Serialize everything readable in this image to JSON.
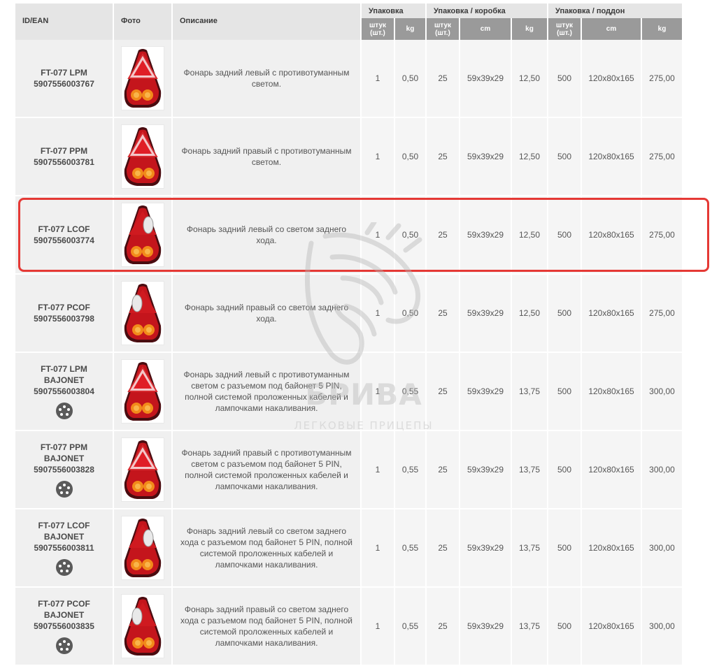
{
  "headers": {
    "id": "ID/EAN",
    "photo": "Фото",
    "description": "Описание",
    "group_pack": "Упаковка",
    "group_box": "Упаковка / коробка",
    "group_pallet": "Упаковка / поддон",
    "sub_pack_pcs": "штук (шт.)",
    "sub_pack_kg": "kg",
    "sub_box_pcs": "штук (шт.)",
    "sub_box_cm": "cm",
    "sub_box_kg": "kg",
    "sub_pallet_pcs": "штук (шт.)",
    "sub_pallet_cm": "cm",
    "sub_pallet_kg": "kg"
  },
  "rows": [
    {
      "model": "FT-077 LPM",
      "suffix": "",
      "ean": "5907556003767",
      "photo_icon": "lamp-left-fog-icon",
      "pin_icon": false,
      "description": "Фонарь задний левый с противотуманным светом.",
      "pack_pcs": "1",
      "pack_kg": "0,50",
      "box_pcs": "25",
      "box_cm": "59x39x29",
      "box_kg": "12,50",
      "pallet_pcs": "500",
      "pallet_cm": "120x80x165",
      "pallet_kg": "275,00"
    },
    {
      "model": "FT-077 PPM",
      "suffix": "",
      "ean": "5907556003781",
      "photo_icon": "lamp-right-fog-icon",
      "pin_icon": false,
      "description": "Фонарь задний правый с противотуманным светом.",
      "pack_pcs": "1",
      "pack_kg": "0,50",
      "box_pcs": "25",
      "box_cm": "59x39x29",
      "box_kg": "12,50",
      "pallet_pcs": "500",
      "pallet_cm": "120x80x165",
      "pallet_kg": "275,00"
    },
    {
      "model": "FT-077 LCOF",
      "suffix": "",
      "ean": "5907556003774",
      "photo_icon": "lamp-left-reverse-icon",
      "pin_icon": false,
      "description": "Фонарь задний левый со светом заднего хода.",
      "pack_pcs": "1",
      "pack_kg": "0,50",
      "box_pcs": "25",
      "box_cm": "59x39x29",
      "box_kg": "12,50",
      "pallet_pcs": "500",
      "pallet_cm": "120x80x165",
      "pallet_kg": "275,00"
    },
    {
      "model": "FT-077 PCOF",
      "suffix": "",
      "ean": "5907556003798",
      "photo_icon": "lamp-right-reverse-icon",
      "pin_icon": false,
      "description": "Фонарь задний правый со светом заднего хода.",
      "pack_pcs": "1",
      "pack_kg": "0,50",
      "box_pcs": "25",
      "box_cm": "59x39x29",
      "box_kg": "12,50",
      "pallet_pcs": "500",
      "pallet_cm": "120x80x165",
      "pallet_kg": "275,00"
    },
    {
      "model": "FT-077 LPM",
      "suffix": "BAJONET",
      "ean": "5907556003804",
      "photo_icon": "lamp-left-fog-icon",
      "pin_icon": true,
      "description": "Фонарь задний левый с противотуманным светом с разъемом под байонет 5 PIN, полной системой проложенных кабелей и лампочками накаливания.",
      "pack_pcs": "1",
      "pack_kg": "0,55",
      "box_pcs": "25",
      "box_cm": "59x39x29",
      "box_kg": "13,75",
      "pallet_pcs": "500",
      "pallet_cm": "120x80x165",
      "pallet_kg": "300,00"
    },
    {
      "model": "FT-077 PPM",
      "suffix": "BAJONET",
      "ean": "5907556003828",
      "photo_icon": "lamp-right-fog-icon",
      "pin_icon": true,
      "description": "Фонарь задний правый с противотуманным светом с разъемом под байонет 5 PIN, полной системой проложенных кабелей и лампочками накаливания.",
      "pack_pcs": "1",
      "pack_kg": "0,55",
      "box_pcs": "25",
      "box_cm": "59x39x29",
      "box_kg": "13,75",
      "pallet_pcs": "500",
      "pallet_cm": "120x80x165",
      "pallet_kg": "300,00"
    },
    {
      "model": "FT-077 LCOF",
      "suffix": "BAJONET",
      "ean": "5907556003811",
      "photo_icon": "lamp-left-reverse-icon",
      "pin_icon": true,
      "description": "Фонарь задний левый со светом заднего хода с разъемом под байонет 5 PIN, полной системой проложенных кабелей и лампочками накаливания.",
      "pack_pcs": "1",
      "pack_kg": "0,55",
      "box_pcs": "25",
      "box_cm": "59x39x29",
      "box_kg": "13,75",
      "pallet_pcs": "500",
      "pallet_cm": "120x80x165",
      "pallet_kg": "300,00"
    },
    {
      "model": "FT-077 PCOF",
      "suffix": "BAJONET",
      "ean": "5907556003835",
      "photo_icon": "lamp-right-reverse-icon",
      "pin_icon": true,
      "description": "Фонарь задний правый со светом заднего хода с разъемом под байонет 5 PIN, полной системой проложенных кабелей и лампочками накаливания.",
      "pack_pcs": "1",
      "pack_kg": "0,55",
      "box_pcs": "25",
      "box_cm": "59x39x29",
      "box_kg": "13,75",
      "pallet_pcs": "500",
      "pallet_cm": "120x80x165",
      "pallet_kg": "300,00"
    }
  ],
  "highlight": {
    "row_index": 2,
    "color": "#e53935"
  },
  "watermark": {
    "brand": "БРИВА",
    "subtitle": "ЛЕГКОВЫЕ ПРИЦЕПЫ",
    "icon": "horse-head-logo-icon"
  },
  "colors": {
    "header_bg": "#e5e5e5",
    "subheader_bg": "#9a9a9a",
    "cell_bg": "#f0f0f0",
    "lamp_red": "#c4151c",
    "lamp_amber": "#f28a1a"
  }
}
